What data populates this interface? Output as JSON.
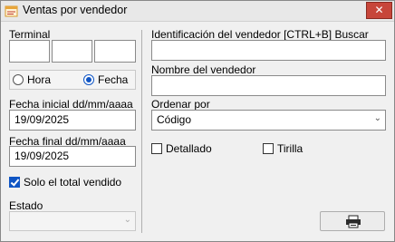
{
  "window": {
    "title": "Ventas por vendedor",
    "close_glyph": "✕"
  },
  "left": {
    "terminal_label": "Terminal",
    "terminal_fields": [
      "",
      "",
      ""
    ],
    "radios": [
      {
        "label": "Hora",
        "checked": false
      },
      {
        "label": "Fecha",
        "checked": true
      }
    ],
    "fecha_inicial_label": "Fecha inicial dd/mm/aaaa",
    "fecha_inicial_value": "19/09/2025",
    "fecha_final_label": "Fecha final dd/mm/aaaa",
    "fecha_final_value": "19/09/2025",
    "solo_total_label": "Solo el total vendido",
    "solo_total_checked": true,
    "estado_label": "Estado",
    "estado_value": ""
  },
  "right": {
    "id_vendedor_label": "Identificación del vendedor [CTRL+B] Buscar",
    "id_vendedor_value": "",
    "nombre_label": "Nombre del vendedor",
    "nombre_value": "",
    "ordenar_label": "Ordenar por",
    "ordenar_value": "Código",
    "detallado_label": "Detallado",
    "detallado_checked": false,
    "tirilla_label": "Tirilla",
    "tirilla_checked": false
  },
  "icons": {
    "app": "report-icon",
    "print": "printer-icon",
    "dropdown": "chevron-down-icon"
  },
  "colors": {
    "accent": "#0f55c4",
    "close": "#c7463a"
  }
}
